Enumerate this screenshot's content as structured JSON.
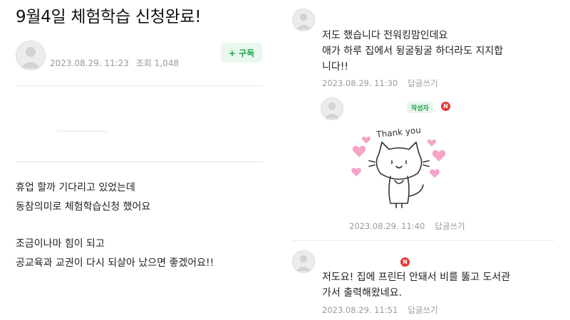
{
  "post": {
    "title": "9월4일 체험학습 신청완료!",
    "date": "2023.08.29. 11:23",
    "views": "조회 1,048",
    "subscribe_label": "+ 구독",
    "body_lines": [
      "휴업 할까 기다리고 있었는데",
      "동참의미로 체험학습신청 했어요",
      "조금이나마 힘이 되고",
      "공교육과 교권이 다시 되살아 났으면 좋겠어요!!"
    ]
  },
  "comments": [
    {
      "lines": [
        "저도 했습니다 전워킹맘인데요",
        "애가 하루 집에서 뒹굴뒹굴 하더라도 지지합",
        "니다!!"
      ],
      "date": "2023.08.29. 11:30",
      "reply": "답글쓰기"
    },
    {
      "writer_badge": "작성자",
      "new_badge": "N",
      "sticker_text": "Thank you",
      "date": "2023.08.29. 11:40",
      "reply": "답글쓰기"
    },
    {
      "new_badge": "N",
      "lines": [
        "저도요! 집에 프린터 안돼서 비를 뚫고 도서관",
        "가서 출력해왔네요."
      ],
      "date": "2023.08.29. 11:51",
      "reply": "답글쓰기"
    }
  ],
  "colors": {
    "accent": "#16a34a",
    "badge_red": "#e53935",
    "meta_gray": "#9a9a9a",
    "heart_pink": "#f5a3c7"
  },
  "icons": {
    "avatar": "default-profile-icon",
    "sticker": "cat-sticker-icon"
  }
}
